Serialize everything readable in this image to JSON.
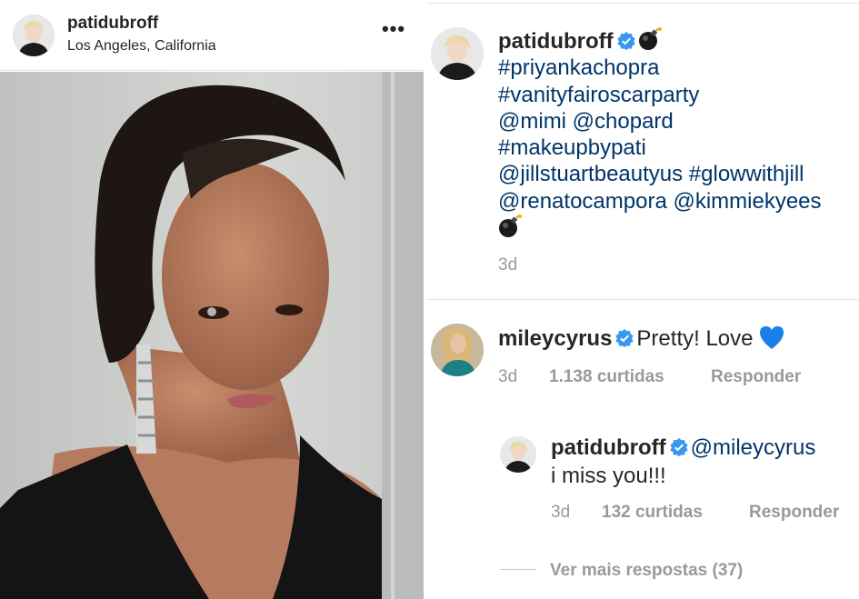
{
  "post": {
    "username": "patidubroff",
    "location": "Los Angeles, California",
    "more_label": "•••"
  },
  "caption": {
    "username": "patidubroff",
    "lines": [
      "#priyankachopra",
      "#vanityfairoscarparty",
      "@mimi @chopard",
      "#makeupbypati",
      "@jillstuartbeautyus #glowwithjill",
      "@renatocampora @kimmiekyees"
    ],
    "time": "3d"
  },
  "comments": [
    {
      "username": "mileycyrus",
      "text": "Pretty! Love",
      "time": "3d",
      "likes": "1.138 curtidas",
      "reply": "Responder"
    },
    {
      "username": "patidubroff",
      "mention": "@mileycyrus",
      "text": "i miss you!!!",
      "time": "3d",
      "likes": "132 curtidas",
      "reply": "Responder"
    }
  ],
  "more_replies": "Ver mais respostas (37)",
  "colors": {
    "link": "#003569",
    "muted": "#999999",
    "text": "#262626",
    "verified": "#3897f0",
    "heart": "#1a7fe8"
  },
  "icons": {
    "verified": "verified-badge-icon",
    "bomb": "bomb-emoji-icon",
    "heart": "blue-heart-emoji-icon",
    "more": "more-options-icon"
  }
}
